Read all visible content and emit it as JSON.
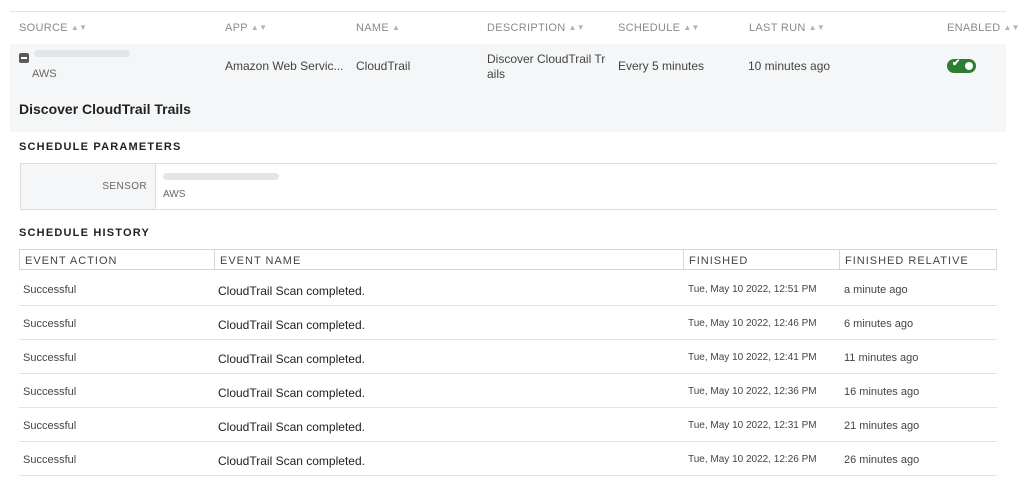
{
  "table": {
    "columns": [
      {
        "label": "SOURCE",
        "sort": "both"
      },
      {
        "label": "APP",
        "sort": "both"
      },
      {
        "label": "NAME",
        "sort": "asc"
      },
      {
        "label": "DESCRIPTION",
        "sort": "both"
      },
      {
        "label": "SCHEDULE",
        "sort": "both"
      },
      {
        "label": "LAST RUN",
        "sort": "both"
      },
      {
        "label": "ENABLED",
        "sort": "both"
      }
    ],
    "row": {
      "source_sub": "AWS",
      "app": "Amazon Web Servic...",
      "name": "CloudTrail",
      "description_line1": "Discover CloudTrail Tr",
      "description_line2": "ails",
      "schedule": "Every 5 minutes",
      "last_run": "10 minutes ago",
      "enabled": true
    }
  },
  "detail": {
    "title": "Discover CloudTrail Trails"
  },
  "schedule_parameters": {
    "heading": "SCHEDULE PARAMETERS",
    "sensor_label": "SENSOR",
    "sensor_sub": "AWS"
  },
  "schedule_history": {
    "heading": "SCHEDULE HISTORY",
    "columns": [
      "EVENT ACTION",
      "EVENT NAME",
      "FINISHED",
      "FINISHED RELATIVE"
    ],
    "rows": [
      {
        "action": "Successful",
        "name": "CloudTrail Scan completed.",
        "finished": "Tue, May 10 2022, 12:51 PM",
        "relative": "a minute ago"
      },
      {
        "action": "Successful",
        "name": "CloudTrail Scan completed.",
        "finished": "Tue, May 10 2022, 12:46 PM",
        "relative": "6 minutes ago"
      },
      {
        "action": "Successful",
        "name": "CloudTrail Scan completed.",
        "finished": "Tue, May 10 2022, 12:41 PM",
        "relative": "11 minutes ago"
      },
      {
        "action": "Successful",
        "name": "CloudTrail Scan completed.",
        "finished": "Tue, May 10 2022, 12:36 PM",
        "relative": "16 minutes ago"
      },
      {
        "action": "Successful",
        "name": "CloudTrail Scan completed.",
        "finished": "Tue, May 10 2022, 12:31 PM",
        "relative": "21 minutes ago"
      },
      {
        "action": "Successful",
        "name": "CloudTrail Scan completed.",
        "finished": "Tue, May 10 2022, 12:26 PM",
        "relative": "26 minutes ago"
      }
    ]
  },
  "colors": {
    "enabled_toggle": "#2f7d32",
    "row_highlight": "#f4f6f7"
  }
}
